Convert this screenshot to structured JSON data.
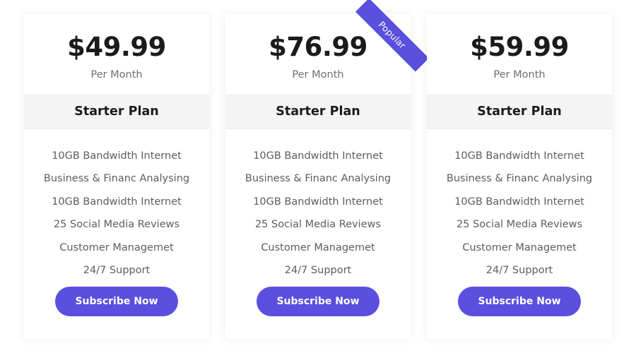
{
  "plans": [
    {
      "price": "$49.99",
      "period": "Per Month",
      "plan_name": "Starter Plan",
      "features": [
        "10GB Bandwidth Internet",
        "Business & Financ Analysing",
        "10GB Bandwidth Internet",
        "25 Social Media Reviews",
        "Customer Managemet",
        "24/7 Support"
      ],
      "cta_label": "Subscribe Now",
      "badge": null
    },
    {
      "price": "$76.99",
      "period": "Per Month",
      "plan_name": "Starter Plan",
      "features": [
        "10GB Bandwidth Internet",
        "Business & Financ Analysing",
        "10GB Bandwidth Internet",
        "25 Social Media Reviews",
        "Customer Managemet",
        "24/7 Support"
      ],
      "cta_label": "Subscribe Now",
      "badge": "Popular"
    },
    {
      "price": "$59.99",
      "period": "Per Month",
      "plan_name": "Starter Plan",
      "features": [
        "10GB Bandwidth Internet",
        "Business & Financ Analysing",
        "10GB Bandwidth Internet",
        "25 Social Media Reviews",
        "Customer Managemet",
        "24/7 Support"
      ],
      "cta_label": "Subscribe Now",
      "badge": null
    }
  ],
  "colors": {
    "accent": "#5b4fe0",
    "price_text": "#1b1b1b",
    "muted_text": "#5d5d5d",
    "band_bg": "#f4f4f4",
    "card_bg": "#ffffff",
    "page_bg": "#ffffff"
  }
}
